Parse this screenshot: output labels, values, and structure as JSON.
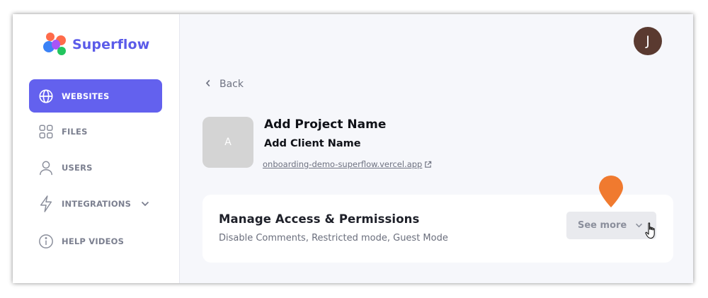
{
  "brand": {
    "name": "Superflow",
    "accent_color": "#6361ee",
    "logo_colors": [
      "#ff6b4a",
      "#a855f7",
      "#3b82f6",
      "#22c55e"
    ]
  },
  "sidebar": {
    "items": [
      {
        "label": "WEBSITES",
        "icon": "globe-icon",
        "active": true
      },
      {
        "label": "FILES",
        "icon": "grid-icon",
        "active": false
      },
      {
        "label": "USERS",
        "icon": "user-icon",
        "active": false
      },
      {
        "label": "INTEGRATIONS",
        "icon": "lightning-icon",
        "active": false,
        "expandable": true
      },
      {
        "label": "HELP VIDEOS",
        "icon": "info-icon",
        "active": false
      }
    ]
  },
  "header": {
    "avatar_initial": "J",
    "avatar_color": "#5a3a30"
  },
  "main": {
    "back_label": "Back",
    "project": {
      "thumb_initial": "A",
      "name": "Add Project Name",
      "client": "Add Client Name",
      "url": "onboarding-demo-superflow.vercel.app"
    },
    "access_card": {
      "title": "Manage Access & Permissions",
      "subtitle": "Disable Comments, Restricted mode, Guest Mode",
      "button_label": "See more"
    },
    "hotspot_color": "#f07a2f"
  }
}
